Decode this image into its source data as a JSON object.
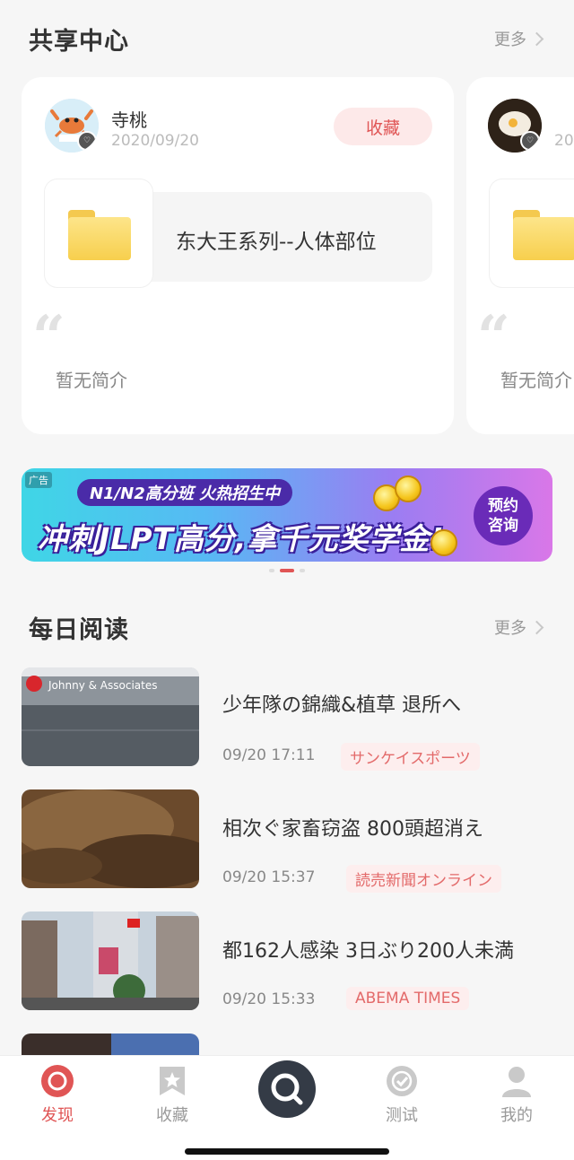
{
  "share_center": {
    "title": "共享中心",
    "more": "更多",
    "cards": [
      {
        "username": "寺桃",
        "date": "2020/09/20",
        "collect_label": "收藏",
        "file_name": "东大王系列--人体部位",
        "intro": "暂无简介",
        "avatar_icon": "crab-avatar-icon"
      },
      {
        "username": "",
        "date": "20",
        "intro": "暂无简介",
        "avatar_icon": "food-avatar-icon"
      }
    ]
  },
  "banner": {
    "ad_tag": "广告",
    "top_text": "N1/N2高分班 火热招生中",
    "main_text": "冲刺JLPT高分,拿千元奖学金!",
    "cta": "预约咨询",
    "colors": {
      "start": "#3fd6e6",
      "end": "#d977e8",
      "badge": "#4a2ba8"
    }
  },
  "daily_reading": {
    "title": "每日阅读",
    "more": "更多",
    "articles": [
      {
        "title": "少年隊の錦織&植草 退所へ",
        "time": "09/20 17:11",
        "source": "サンケイスポーツ"
      },
      {
        "title": "相次ぐ家畜窃盗 800頭超消え",
        "time": "09/20 15:37",
        "source": "読売新聞オンライン"
      },
      {
        "title": "都162人感染 3日ぶり200人未満",
        "time": "09/20 15:33",
        "source": "ABEMA TIMES"
      }
    ]
  },
  "tabbar": {
    "items": [
      {
        "label": "发现",
        "icon": "discover-icon",
        "active": true
      },
      {
        "label": "收藏",
        "icon": "star-bookmark-icon",
        "active": false
      },
      {
        "label": "",
        "icon": "search-icon",
        "active": false
      },
      {
        "label": "测试",
        "icon": "check-test-icon",
        "active": false
      },
      {
        "label": "我的",
        "icon": "person-icon",
        "active": false
      }
    ]
  },
  "colors": {
    "accent": "#e05555",
    "background": "#f6f6f6"
  }
}
